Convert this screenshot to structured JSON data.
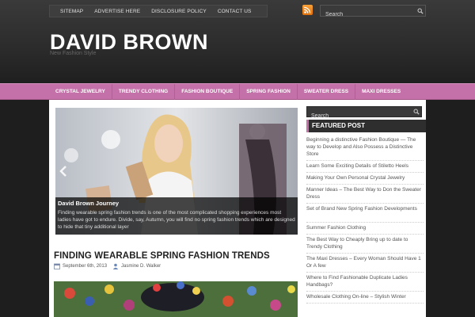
{
  "top_nav": {
    "items": [
      "SITEMAP",
      "ADVERTISE HERE",
      "DISCLOSURE POLICY",
      "CONTACT US"
    ]
  },
  "search": {
    "placeholder": "Search"
  },
  "site": {
    "title": "DAVID BROWN",
    "tagline": "New Fashion Style"
  },
  "main_nav": {
    "items": [
      "CRYSTAL JEWELRY",
      "TRENDY CLOTHING",
      "FASHION BOUTIQUE",
      "SPRING FASHION",
      "SWEATER DRESS",
      "MAXI DRESSES"
    ]
  },
  "slider": {
    "title": "David Brown Journey",
    "text": "Finding wearable spring fashion trends is one of the most complicated shopping experiences most ladies have got to endure. Divide, say, Autumn, you will find no spring fashion trends which are designed to hide that tiny additional layer",
    "prev_icon": "arrow-left-icon"
  },
  "post": {
    "title": "FINDING WEARABLE SPRING FASHION TRENDS",
    "date": "September 6th, 2013",
    "author": "Jasmine D. Walker"
  },
  "sidebar": {
    "search_placeholder": "Search",
    "featured_title": "FEATURED POST",
    "featured": [
      "Beginning a distinctive Fashion Boutique — The way to Develop and Also Possess a Distinctive Store",
      "Learn Some Exciting Details of Stiletto Heels",
      "Making Your Own Personal Crystal Jewelry",
      "Manner Ideas – The Best Way to Don the Sweater Dress",
      "Set of Brand New Spring Fashion Developments",
      "Summer Fashion Clothing",
      "The Best Way to Cheaply Bring up to date to Trendy Clothing",
      "The Maxi Dresses – Every Woman Should Have 1 Or A few",
      "Where to Find Fashionable Duplicate Ladies Handbags?",
      "Wholesale Clothing On-line – Stylish Winter"
    ]
  },
  "colors": {
    "accent": "#c571a9",
    "rss": "#f08a24",
    "background": "#1e1e1e"
  }
}
